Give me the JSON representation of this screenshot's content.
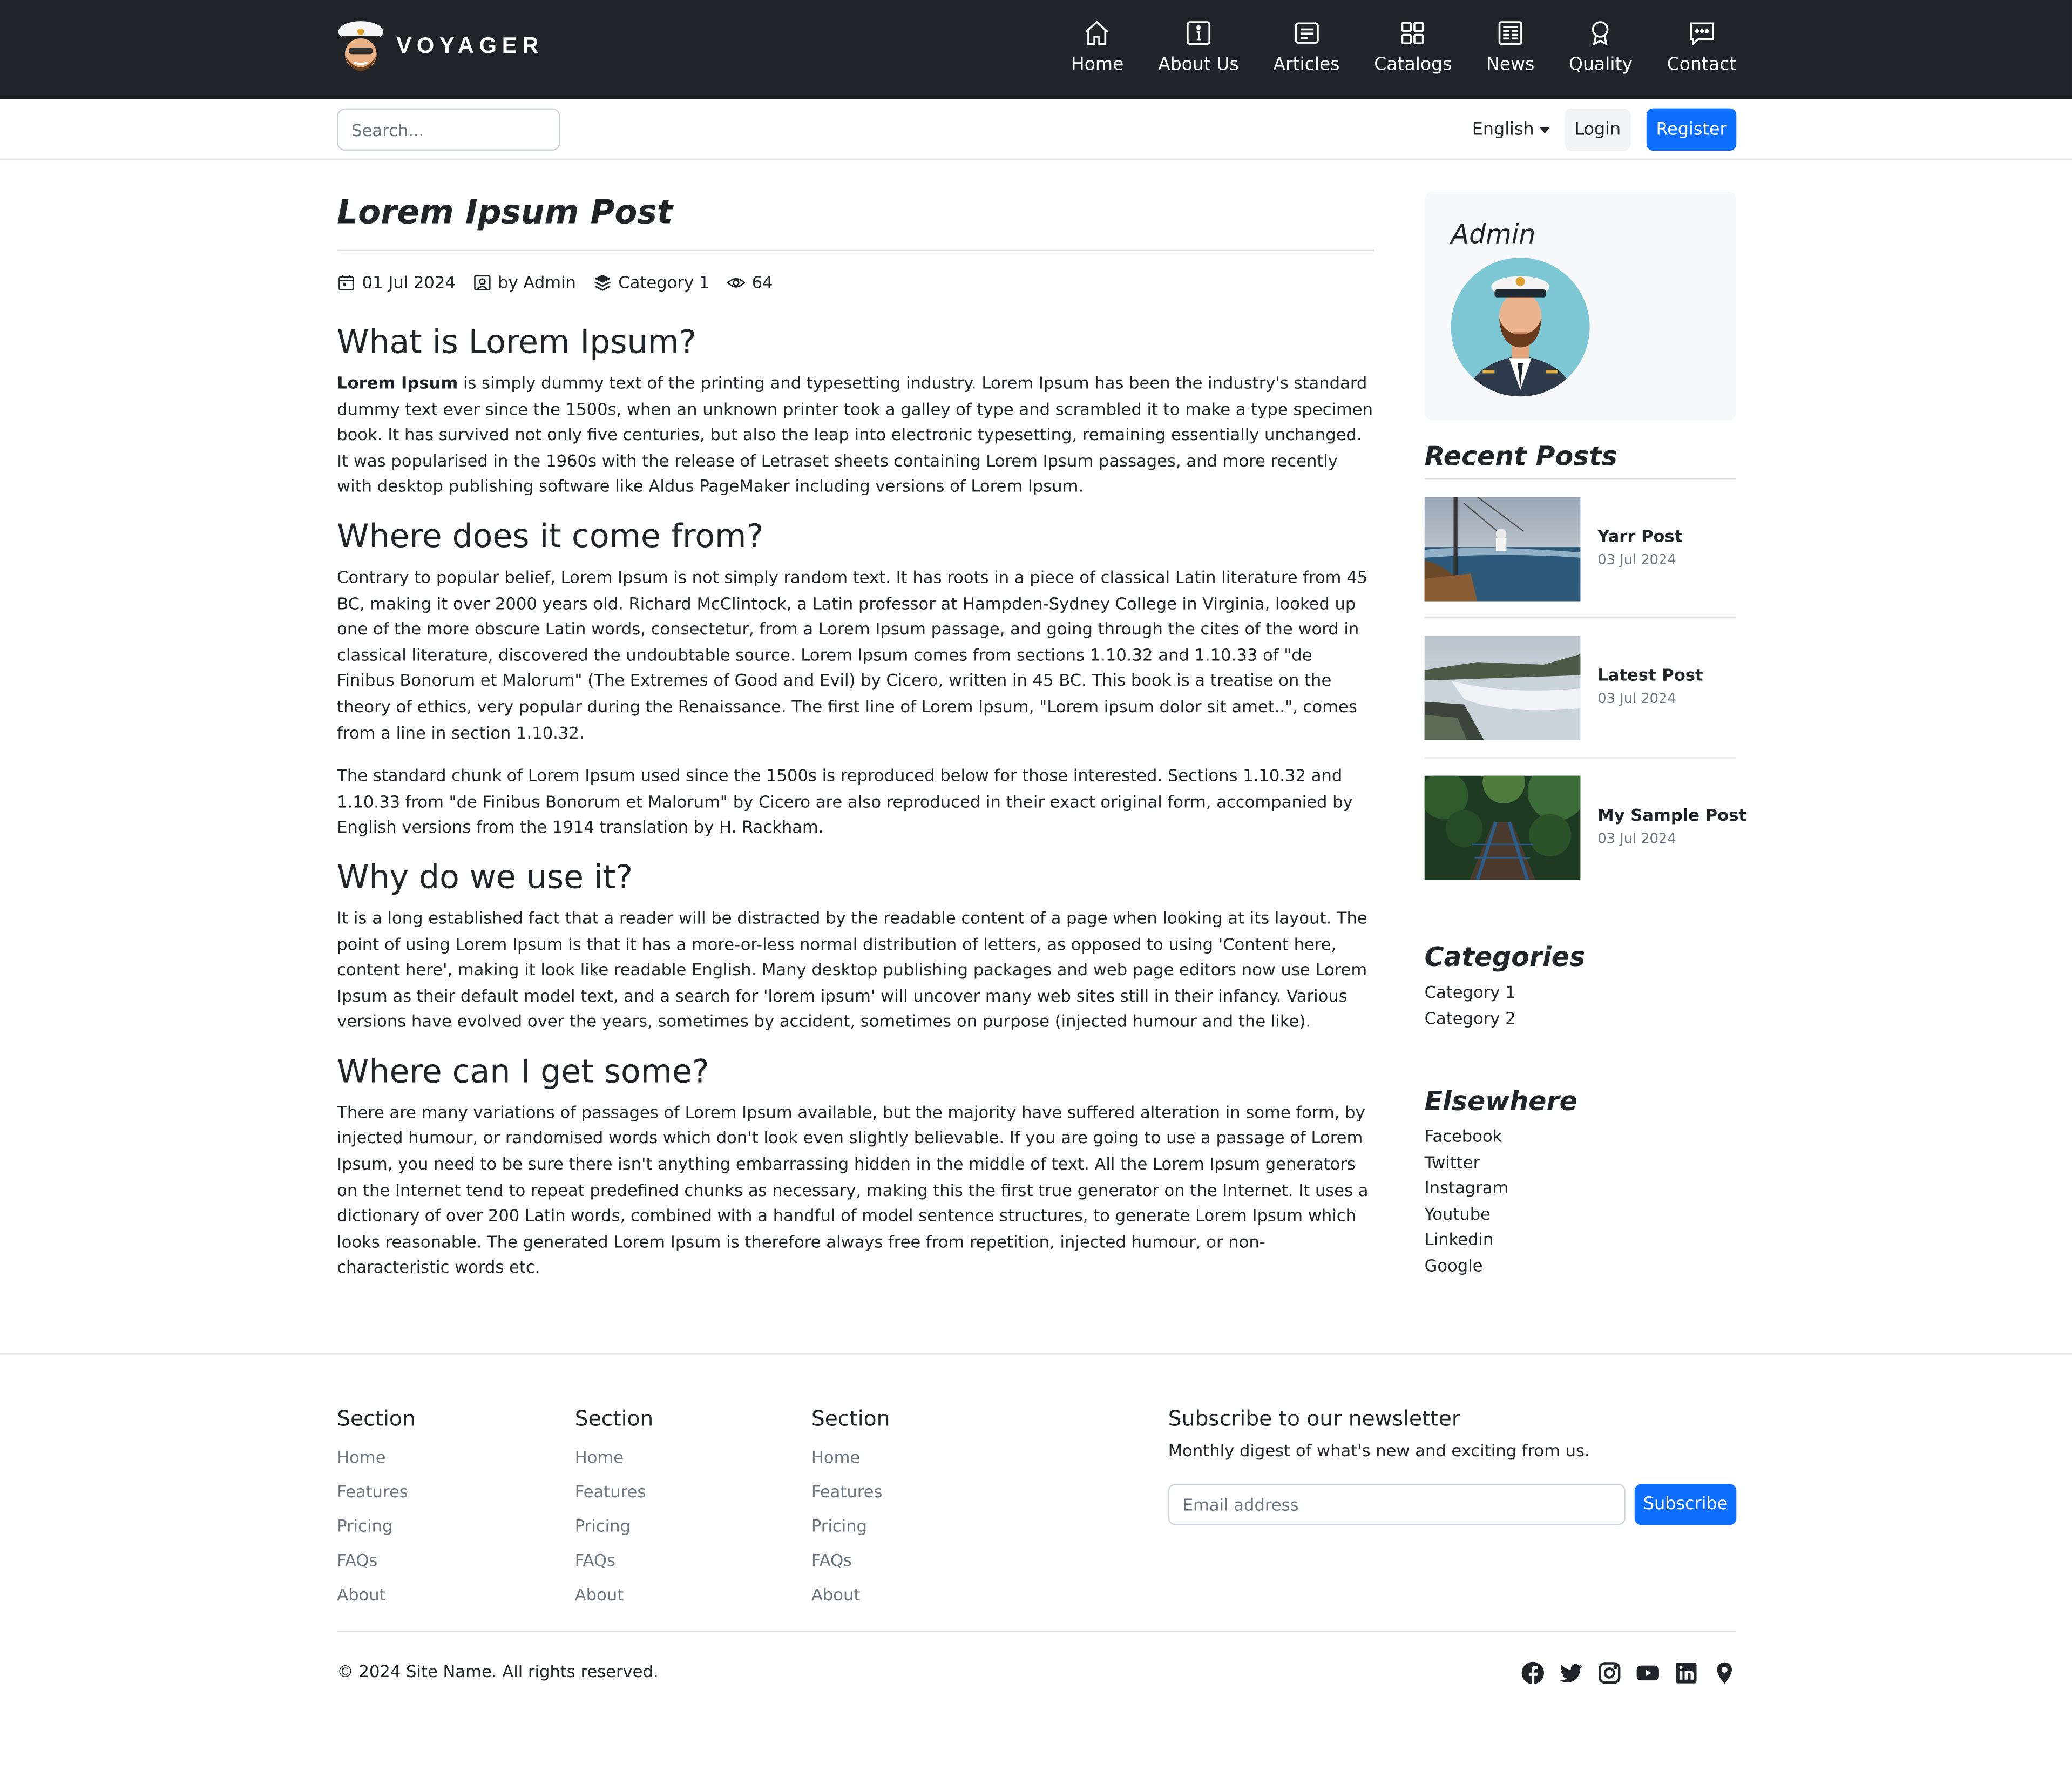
{
  "brand": {
    "name": "VOYAGER"
  },
  "nav": {
    "items": [
      {
        "label": "Home",
        "icon": "house-icon"
      },
      {
        "label": "About Us",
        "icon": "info-icon"
      },
      {
        "label": "Articles",
        "icon": "article-icon"
      },
      {
        "label": "Catalogs",
        "icon": "grid-icon"
      },
      {
        "label": "News",
        "icon": "newspaper-icon"
      },
      {
        "label": "Quality",
        "icon": "award-icon"
      },
      {
        "label": "Contact",
        "icon": "chat-icon"
      }
    ]
  },
  "subbar": {
    "search_placeholder": "Search...",
    "language": "English",
    "login_label": "Login",
    "register_label": "Register"
  },
  "post": {
    "title": "Lorem Ipsum Post",
    "date": "01 Jul 2024",
    "author": "by Admin",
    "category": "Category 1",
    "views": "64",
    "sections": [
      {
        "heading": "What is Lorem Ipsum?",
        "lead": "Lorem Ipsum",
        "paragraphs": [
          " is simply dummy text of the printing and typesetting industry. Lorem Ipsum has been the industry's standard dummy text ever since the 1500s, when an unknown printer took a galley of type and scrambled it to make a type specimen book. It has survived not only five centuries, but also the leap into electronic typesetting, remaining essentially unchanged. It was popularised in the 1960s with the release of Letraset sheets containing Lorem Ipsum passages, and more recently with desktop publishing software like Aldus PageMaker including versions of Lorem Ipsum."
        ]
      },
      {
        "heading": "Where does it come from?",
        "paragraphs": [
          "Contrary to popular belief, Lorem Ipsum is not simply random text. It has roots in a piece of classical Latin literature from 45 BC, making it over 2000 years old. Richard McClintock, a Latin professor at Hampden-Sydney College in Virginia, looked up one of the more obscure Latin words, consectetur, from a Lorem Ipsum passage, and going through the cites of the word in classical literature, discovered the undoubtable source. Lorem Ipsum comes from sections 1.10.32 and 1.10.33 of \"de Finibus Bonorum et Malorum\" (The Extremes of Good and Evil) by Cicero, written in 45 BC. This book is a treatise on the theory of ethics, very popular during the Renaissance. The first line of Lorem Ipsum, \"Lorem ipsum dolor sit amet..\", comes from a line in section 1.10.32.",
          "The standard chunk of Lorem Ipsum used since the 1500s is reproduced below for those interested. Sections 1.10.32 and 1.10.33 from \"de Finibus Bonorum et Malorum\" by Cicero are also reproduced in their exact original form, accompanied by English versions from the 1914 translation by H. Rackham."
        ]
      },
      {
        "heading": "Why do we use it?",
        "paragraphs": [
          "It is a long established fact that a reader will be distracted by the readable content of a page when looking at its layout. The point of using Lorem Ipsum is that it has a more-or-less normal distribution of letters, as opposed to using 'Content here, content here', making it look like readable English. Many desktop publishing packages and web page editors now use Lorem Ipsum as their default model text, and a search for 'lorem ipsum' will uncover many web sites still in their infancy. Various versions have evolved over the years, sometimes by accident, sometimes on purpose (injected humour and the like)."
        ]
      },
      {
        "heading": "Where can I get some?",
        "paragraphs": [
          "There are many variations of passages of Lorem Ipsum available, but the majority have suffered alteration in some form, by injected humour, or randomised words which don't look even slightly believable. If you are going to use a passage of Lorem Ipsum, you need to be sure there isn't anything embarrassing hidden in the middle of text. All the Lorem Ipsum generators on the Internet tend to repeat predefined chunks as necessary, making this the first true generator on the Internet. It uses a dictionary of over 200 Latin words, combined with a handful of model sentence structures, to generate Lorem Ipsum which looks reasonable. The generated Lorem Ipsum is therefore always free from repetition, injected humour, or non-characteristic words etc."
        ]
      }
    ]
  },
  "sidebar": {
    "admin_name": "Admin",
    "recent_heading": "Recent Posts",
    "recent_posts": [
      {
        "title": "Yarr Post",
        "date": "03 Jul 2024"
      },
      {
        "title": "Latest Post",
        "date": "03 Jul 2024"
      },
      {
        "title": "My Sample Post",
        "date": "03 Jul 2024"
      }
    ],
    "categories_heading": "Categories",
    "categories": [
      "Category 1",
      "Category 2"
    ],
    "elsewhere_heading": "Elsewhere",
    "elsewhere": [
      "Facebook",
      "Twitter",
      "Instagram",
      "Youtube",
      "Linkedin",
      "Google"
    ]
  },
  "footer": {
    "columns": [
      {
        "heading": "Section",
        "links": [
          "Home",
          "Features",
          "Pricing",
          "FAQs",
          "About"
        ]
      },
      {
        "heading": "Section",
        "links": [
          "Home",
          "Features",
          "Pricing",
          "FAQs",
          "About"
        ]
      },
      {
        "heading": "Section",
        "links": [
          "Home",
          "Features",
          "Pricing",
          "FAQs",
          "About"
        ]
      }
    ],
    "newsletter_heading": "Subscribe to our newsletter",
    "newsletter_text": "Monthly digest of what's new and exciting from us.",
    "email_placeholder": "Email address",
    "subscribe_label": "Subscribe",
    "copyright": "© 2024 Site Name. All rights reserved.",
    "social_icons": [
      "facebook-icon",
      "twitter-icon",
      "instagram-icon",
      "youtube-icon",
      "linkedin-icon",
      "location-pin-icon"
    ]
  },
  "colors": {
    "primary": "#0d6efd",
    "navbar": "#212529",
    "sidebar_bg": "#f8f9fa",
    "muted": "#6c757d"
  }
}
